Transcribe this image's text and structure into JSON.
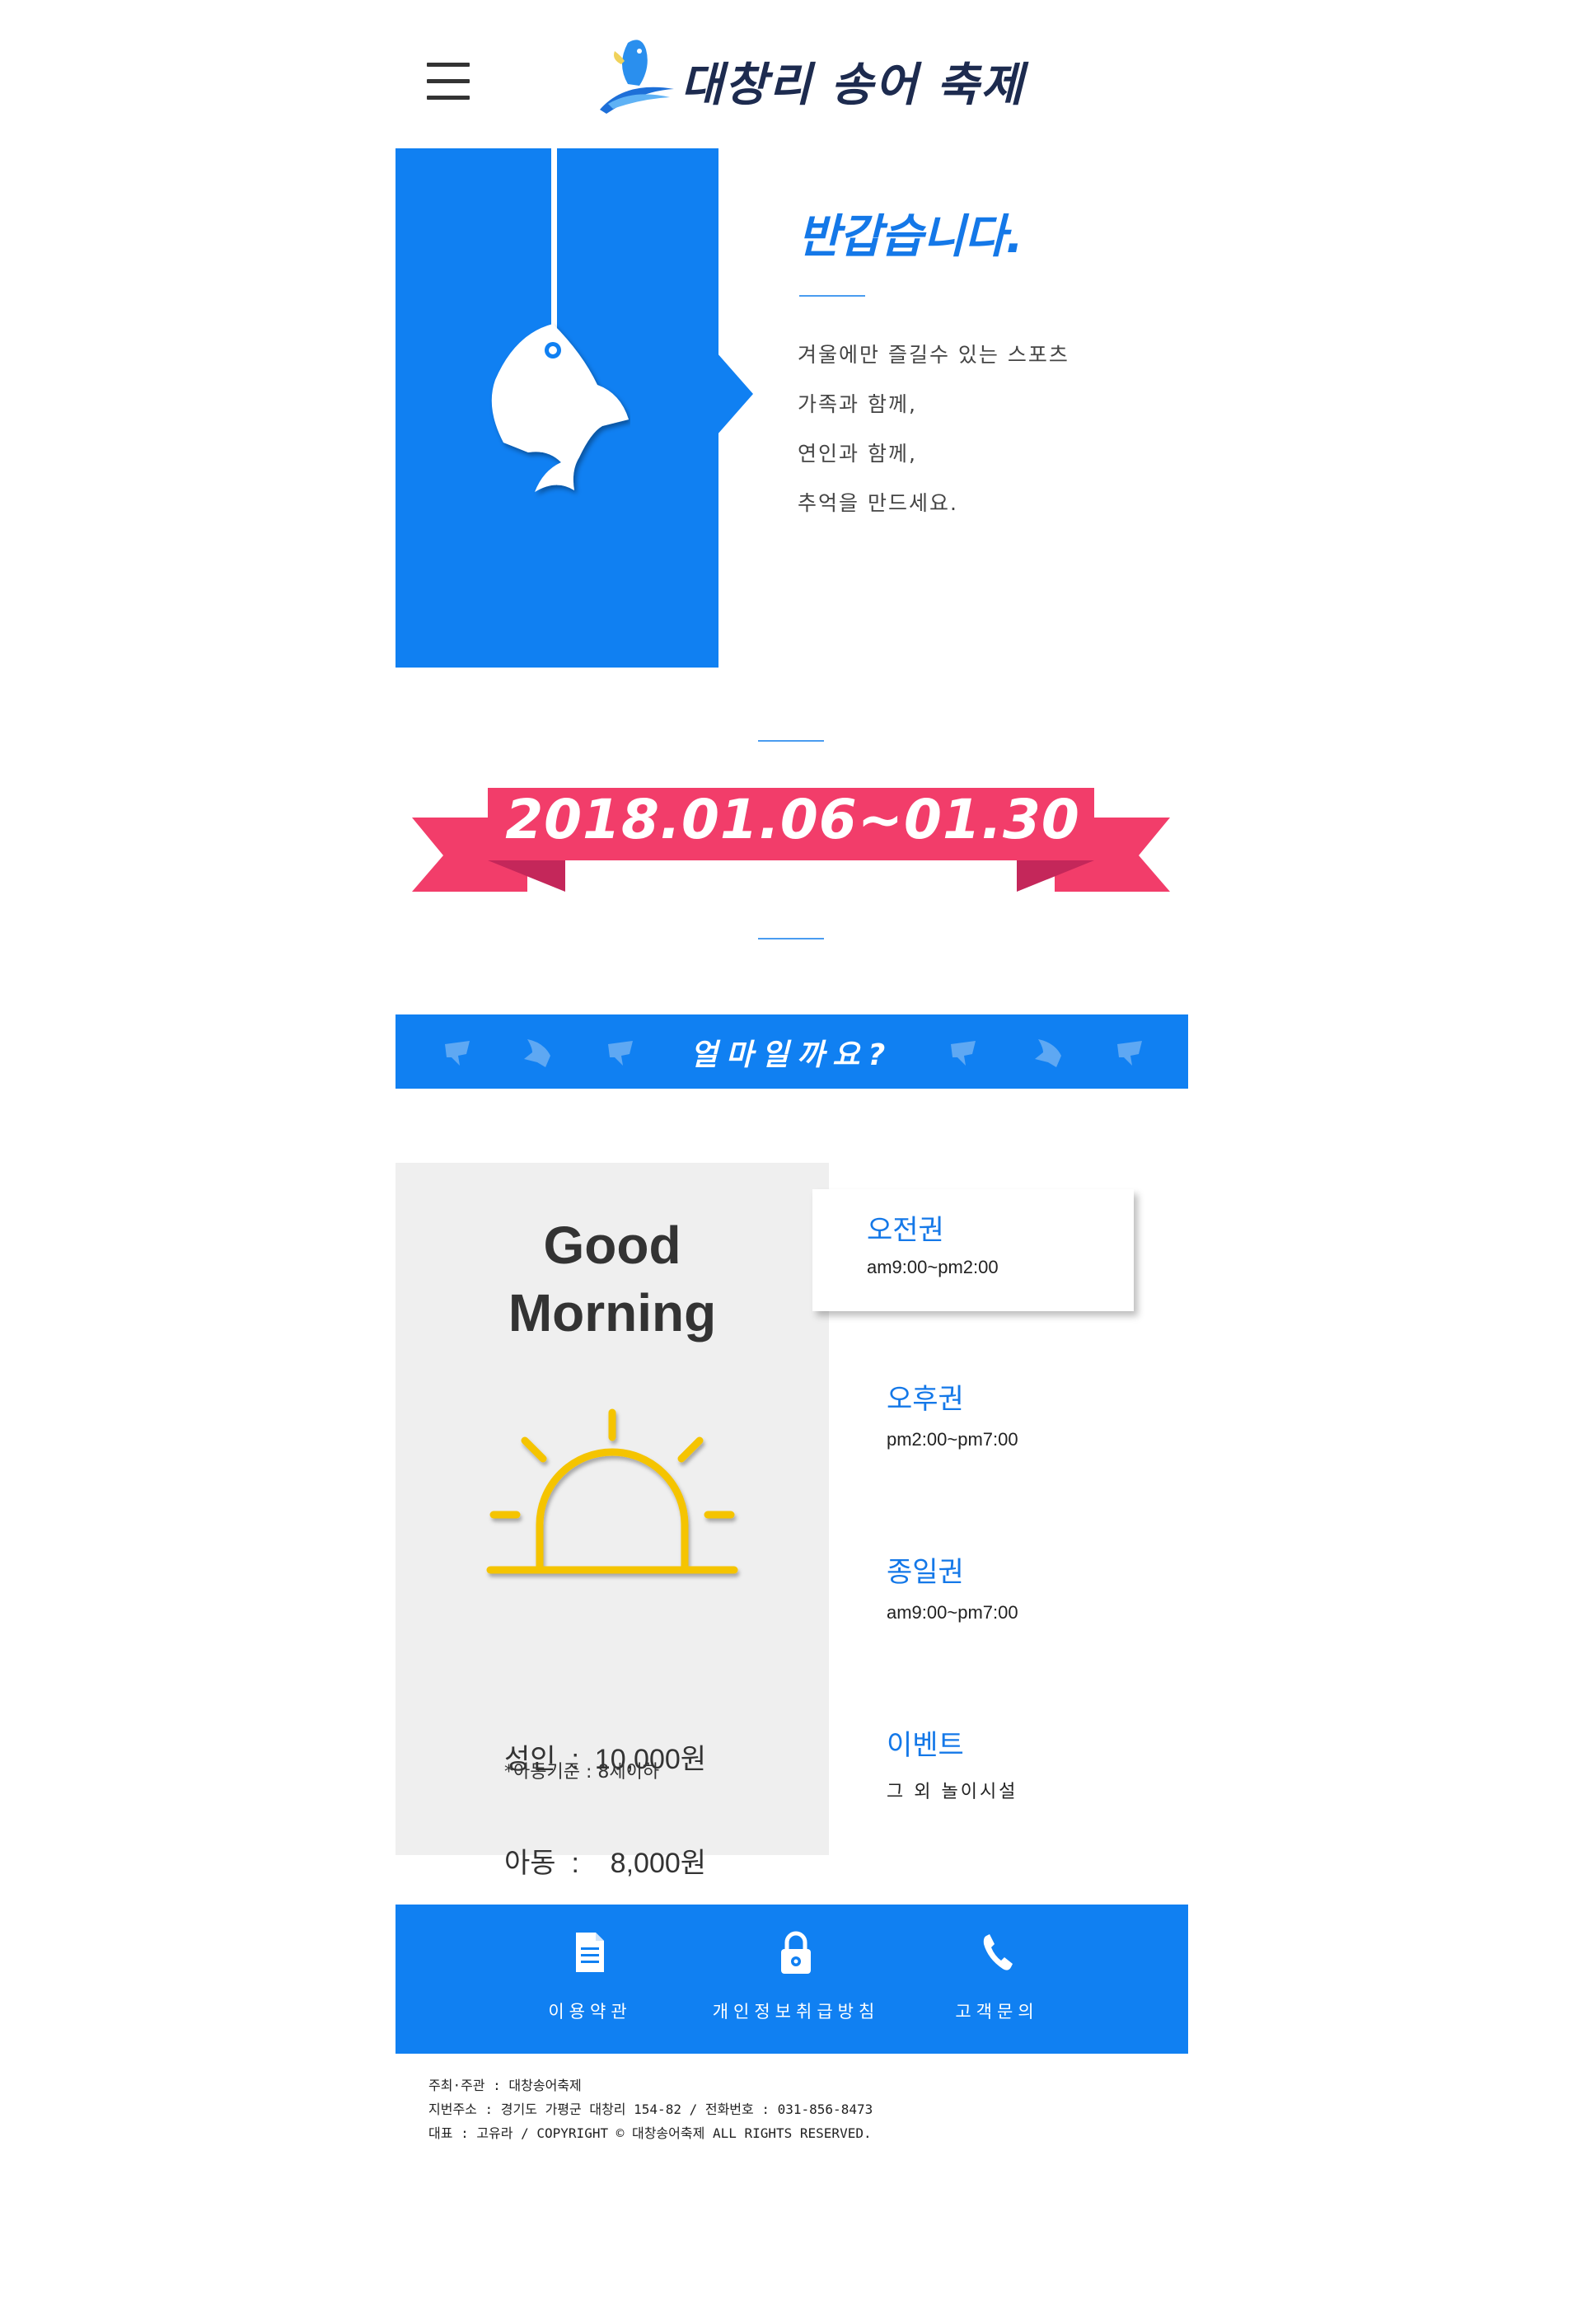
{
  "header": {
    "logo_text": "대창리 송어 축제"
  },
  "intro": {
    "title": "반갑습니다.",
    "lines": [
      "겨울에만 즐길수 있는 스포츠",
      "가족과 함께,",
      "연인과 함께,",
      "추억을 만드세요."
    ]
  },
  "festival": {
    "dates": "2018.01.06~01.30"
  },
  "pricing_banner": {
    "title": "얼마일까요?"
  },
  "pricing": {
    "greeting": [
      "Good",
      "Morning"
    ],
    "adult": "성인  :  10,000원",
    "child": "아동  :    8,000원",
    "note": "*아동기준 : 8세이하",
    "tickets": [
      {
        "title": "오전권",
        "time": "am9:00~pm2:00"
      },
      {
        "title": "오후권",
        "time": "pm2:00~pm7:00"
      },
      {
        "title": "종일권",
        "time": "am9:00~pm7:00"
      },
      {
        "title": "이벤트",
        "time": "그 외 놀이시설"
      }
    ]
  },
  "footer_nav": {
    "items": [
      {
        "label": "이용약관",
        "icon": "document-icon"
      },
      {
        "label": "개인정보취급방침",
        "icon": "lock-icon"
      },
      {
        "label": "고객문의",
        "icon": "phone-icon"
      }
    ]
  },
  "footer_info": {
    "lines": [
      "주최·주관 : 대창송어축제",
      "지번주소 : 경기도 가평군 대창리 154-82  / 전화번호 : 031-856-8473",
      "대표 : 고유라 / COPYRIGHT © 대창송어축제 ALL RIGHTS RESERVED."
    ]
  },
  "colors": {
    "primary_blue": "#1080f2",
    "ribbon_pink": "#f23d6a",
    "ribbon_dark": "#c4275a",
    "sun_yellow": "#f5c400",
    "panel_gray": "#efefef"
  }
}
